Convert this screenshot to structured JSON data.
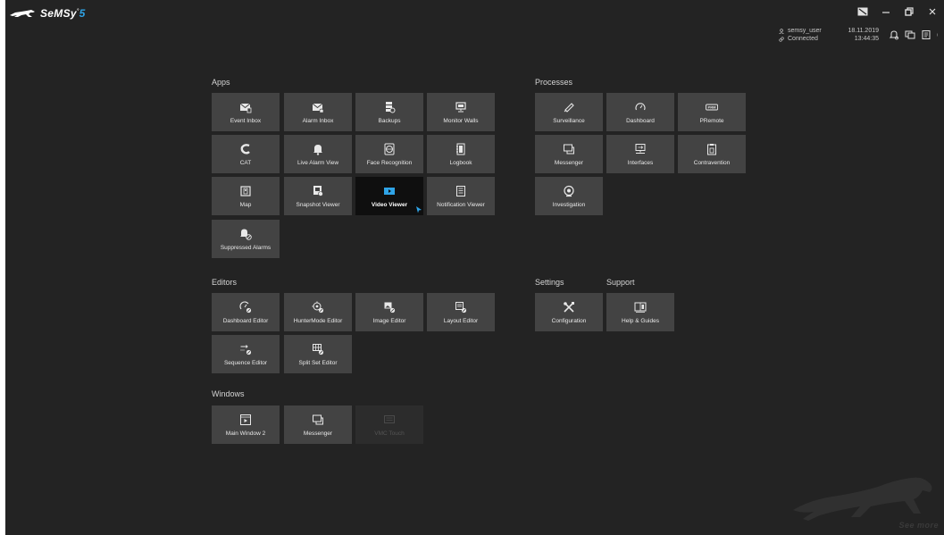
{
  "app": {
    "brand_name": "SeMSy",
    "brand_version": "5",
    "user": "semsy_user",
    "connection": "Connected",
    "date": "18.11.2019",
    "time": "13:44:35",
    "watermark_text": "See more",
    "accent_color": "#2fa4e7"
  },
  "sections": {
    "apps": "Apps",
    "processes": "Processes",
    "editors": "Editors",
    "settings": "Settings",
    "support": "Support",
    "windows": "Windows"
  },
  "apps": [
    {
      "label": "Event Inbox",
      "icon": "envelope-icon"
    },
    {
      "label": "Alarm Inbox",
      "icon": "alarm-envelope-icon"
    },
    {
      "label": "Backups",
      "icon": "database-icon"
    },
    {
      "label": "Monitor Walls",
      "icon": "monitor-icon"
    },
    {
      "label": "CAT",
      "icon": "cat-icon"
    },
    {
      "label": "Live Alarm View",
      "icon": "bell-icon"
    },
    {
      "label": "Face Recognition",
      "icon": "face-icon"
    },
    {
      "label": "Logbook",
      "icon": "book-icon"
    },
    {
      "label": "Map",
      "icon": "map-icon"
    },
    {
      "label": "Snapshot Viewer",
      "icon": "snapshot-icon"
    },
    {
      "label": "Video Viewer",
      "icon": "play-icon"
    },
    {
      "label": "Notification Viewer",
      "icon": "notification-icon"
    },
    {
      "label": "Suppressed Alarms",
      "icon": "bell-mute-icon"
    }
  ],
  "processes": [
    {
      "label": "Surveillance",
      "icon": "camera-icon"
    },
    {
      "label": "Dashboard",
      "icon": "gauge-icon"
    },
    {
      "label": "PRemote",
      "icon": "prm-icon"
    },
    {
      "label": "Messenger",
      "icon": "chat-icon"
    },
    {
      "label": "Interfaces",
      "icon": "interfaces-icon"
    },
    {
      "label": "Contravention",
      "icon": "clipboard-icon"
    },
    {
      "label": "Investigation",
      "icon": "investigation-icon"
    }
  ],
  "editors": [
    {
      "label": "Dashboard Editor",
      "icon": "gauge-edit-icon"
    },
    {
      "label": "HunterMode Editor",
      "icon": "target-edit-icon"
    },
    {
      "label": "Image Editor",
      "icon": "image-edit-icon"
    },
    {
      "label": "Layout Editor",
      "icon": "layout-edit-icon"
    },
    {
      "label": "Sequence Editor",
      "icon": "sequence-edit-icon"
    },
    {
      "label": "Split Set Editor",
      "icon": "split-edit-icon"
    }
  ],
  "settings": [
    {
      "label": "Configuration",
      "icon": "tools-icon"
    }
  ],
  "support": [
    {
      "label": "Help & Guides",
      "icon": "help-book-icon"
    }
  ],
  "windows": [
    {
      "label": "Main Window 2",
      "icon": "window-icon"
    },
    {
      "label": "Messenger",
      "icon": "chat-icon"
    },
    {
      "label": "VMC Touch",
      "icon": "vmc-icon",
      "disabled": true
    }
  ]
}
